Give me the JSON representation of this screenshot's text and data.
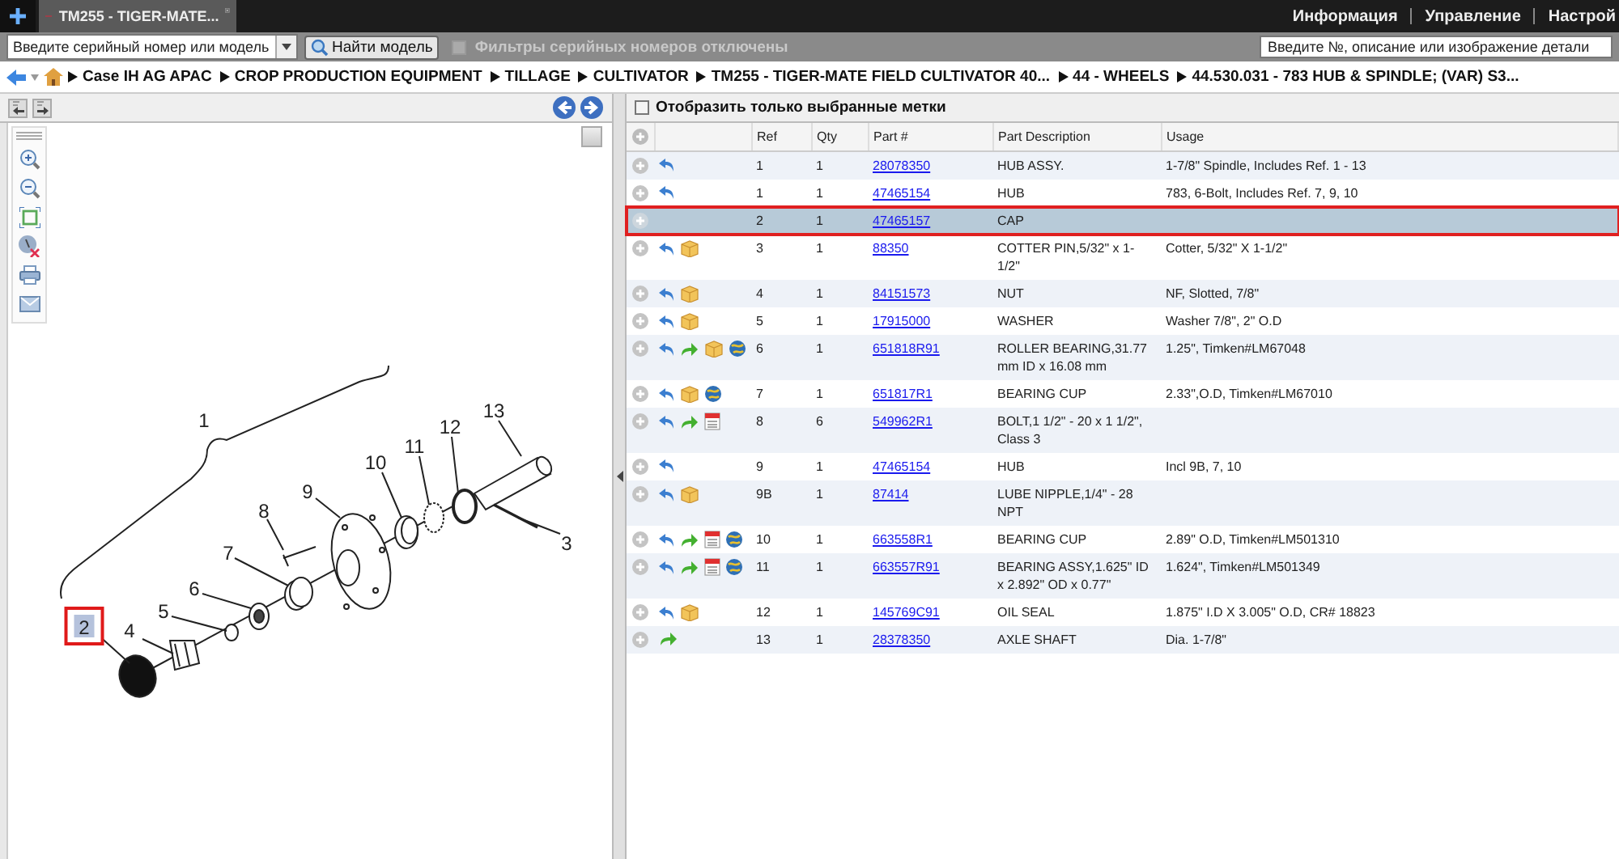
{
  "top_bar": {
    "tab": {
      "title": "TM255 - TIGER-MATE...",
      "selected": true
    },
    "links": [
      "Информация",
      "Управление",
      "Настрой"
    ]
  },
  "toolbar": {
    "serial_field": {
      "placeholder": "Введите серийный номер или модель"
    },
    "find_button": "Найти модель",
    "serial_filter": {
      "label": "Фильтры серийных номеров отключены",
      "checked": false,
      "disabled": true
    },
    "part_search": {
      "placeholder": "Введите №, описание или изображение детали"
    }
  },
  "breadcrumb": [
    "Case IH AG APAC",
    "CROP PRODUCTION EQUIPMENT",
    "TILLAGE",
    "CULTIVATOR",
    "TM255 - TIGER-MATE FIELD CULTIVATOR 40...",
    "44 - WHEELS",
    "44.530.031 - 783 HUB & SPINDLE; (VAR) S3..."
  ],
  "diagram": {
    "callouts": [
      {
        "label": "1",
        "selected": false
      },
      {
        "label": "2",
        "selected": true
      },
      {
        "label": "3",
        "selected": false
      },
      {
        "label": "4",
        "selected": false
      },
      {
        "label": "5",
        "selected": false
      },
      {
        "label": "6",
        "selected": false
      },
      {
        "label": "7",
        "selected": false
      },
      {
        "label": "8",
        "selected": false
      },
      {
        "label": "9",
        "selected": false
      },
      {
        "label": "10",
        "selected": false
      },
      {
        "label": "11",
        "selected": false
      },
      {
        "label": "12",
        "selected": false
      },
      {
        "label": "13",
        "selected": false
      }
    ]
  },
  "parts_panel": {
    "filter": {
      "label": "Отобразить только выбранные метки",
      "checked": false
    },
    "columns": [
      "Ref",
      "Qty",
      "Part #",
      "Part Description",
      "Usage"
    ],
    "rows": [
      {
        "icons": [
          {
            "kind": "return"
          }
        ],
        "ref": "1",
        "qty": "1",
        "part": "28078350",
        "description": "HUB ASSY.",
        "usage": "1-7/8\" Spindle, Includes Ref. 1 - 13",
        "selected": false
      },
      {
        "icons": [
          {
            "kind": "return"
          }
        ],
        "ref": "1",
        "qty": "1",
        "part": "47465154",
        "description": "HUB",
        "usage": "783, 6-Bolt, Includes Ref. 7, 9, 10",
        "selected": false
      },
      {
        "ref": "2",
        "qty": "1",
        "part": "47465157",
        "description": "CAP",
        "selected": true
      },
      {
        "icons": [
          {
            "kind": "return"
          },
          {
            "kind": "box"
          }
        ],
        "ref": "3",
        "qty": "1",
        "part": "88350",
        "description": "COTTER PIN,5/32\" x 1-1/2\"",
        "usage": "Cotter, 5/32\" X 1-1/2\"",
        "selected": false
      },
      {
        "icons": [
          {
            "kind": "return"
          },
          {
            "kind": "box"
          }
        ],
        "ref": "4",
        "qty": "1",
        "part": "84151573",
        "description": "NUT",
        "usage": "NF, Slotted, 7/8\"",
        "selected": false
      },
      {
        "icons": [
          {
            "kind": "return"
          },
          {
            "kind": "box"
          }
        ],
        "ref": "5",
        "qty": "1",
        "part": "17915000",
        "description": "WASHER",
        "usage": "Washer 7/8\", 2\" O.D",
        "selected": false
      },
      {
        "icons": [
          {
            "kind": "return"
          },
          {
            "kind": "forward"
          },
          {
            "kind": "box"
          },
          {
            "kind": "globe"
          }
        ],
        "ref": "6",
        "qty": "1",
        "part": "651818R91",
        "description": "ROLLER BEARING,31.77 mm ID x 16.08 mm",
        "usage": "1.25\", Timken#LM67048",
        "selected": false
      },
      {
        "icons": [
          {
            "kind": "return"
          },
          {
            "kind": "box"
          },
          {
            "kind": "globe"
          }
        ],
        "ref": "7",
        "qty": "1",
        "part": "651817R1",
        "description": "BEARING CUP",
        "usage": "2.33\",O.D, Timken#LM67010",
        "selected": false
      },
      {
        "icons": [
          {
            "kind": "return"
          },
          {
            "kind": "forward"
          },
          {
            "kind": "list"
          }
        ],
        "ref": "8",
        "qty": "6",
        "part": "549962R1",
        "description": "BOLT,1 1/2\" - 20 x 1 1/2\", Class 3",
        "selected": false
      },
      {
        "icons": [
          {
            "kind": "return"
          }
        ],
        "ref": "9",
        "qty": "1",
        "part": "47465154",
        "description": "HUB",
        "usage": "Incl 9B, 7, 10",
        "selected": false
      },
      {
        "icons": [
          {
            "kind": "return"
          },
          {
            "kind": "box"
          }
        ],
        "ref": "9B",
        "qty": "1",
        "part": "87414",
        "description": "LUBE NIPPLE,1/4\" - 28 NPT",
        "selected": false
      },
      {
        "icons": [
          {
            "kind": "return"
          },
          {
            "kind": "forward"
          },
          {
            "kind": "list"
          },
          {
            "kind": "globe"
          }
        ],
        "ref": "10",
        "qty": "1",
        "part": "663558R1",
        "description": "BEARING CUP",
        "usage": "2.89\" O.D, Timken#LM501310",
        "selected": false
      },
      {
        "icons": [
          {
            "kind": "return"
          },
          {
            "kind": "forward"
          },
          {
            "kind": "list"
          },
          {
            "kind": "globe"
          }
        ],
        "ref": "11",
        "qty": "1",
        "part": "663557R91",
        "description": "BEARING ASSY,1.625\" ID x 2.892\" OD x 0.77\"",
        "usage": "1.624\", Timken#LM501349",
        "selected": false
      },
      {
        "icons": [
          {
            "kind": "return"
          },
          {
            "kind": "box"
          }
        ],
        "ref": "12",
        "qty": "1",
        "part": "145769C91",
        "description": "OIL SEAL",
        "usage": "1.875\" I.D X 3.005\" O.D, CR# 18823",
        "selected": false
      },
      {
        "icons": [
          {
            "kind": "forward"
          }
        ],
        "ref": "13",
        "qty": "1",
        "part": "28378350",
        "description": "AXLE SHAFT",
        "usage": "Dia. 1-7/8\"",
        "selected": false
      }
    ]
  }
}
